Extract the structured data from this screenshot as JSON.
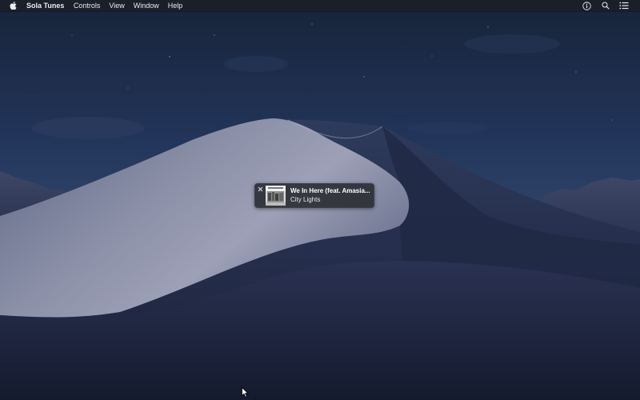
{
  "menubar": {
    "app_name": "Sola Tunes",
    "menus": [
      "Controls",
      "View",
      "Window",
      "Help"
    ],
    "apple_icon": "apple-logo-icon",
    "status_icons": [
      "info-circle-icon",
      "search-icon",
      "list-icon"
    ]
  },
  "mini_player": {
    "track_title": "We In Here (feat. Amasia...",
    "track_artist": "City Lights",
    "close_icon": "close-icon",
    "artwork_icon": "album-artwork-icon"
  },
  "colors": {
    "sky_top": "#1b2a44",
    "sky_bottom": "#2f4468",
    "dune_light": "#8a8ea6",
    "dune_dark": "#1e2540",
    "menubar_bg": "#1c1e26",
    "player_bg": "#282a30"
  }
}
